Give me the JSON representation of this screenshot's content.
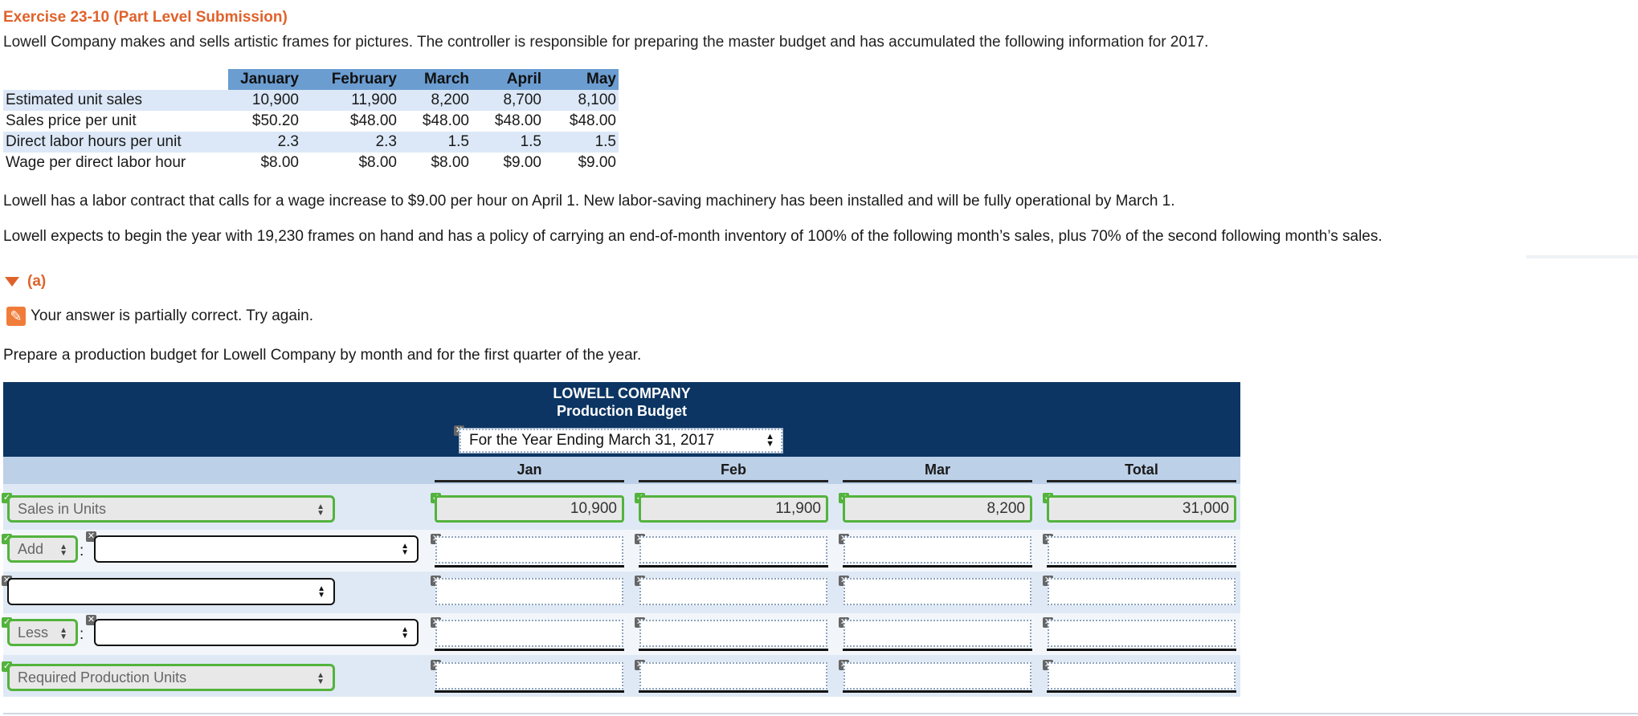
{
  "exercise": {
    "title": "Exercise 23-10 (Part Level Submission)",
    "intro": "Lowell Company makes and sells artistic frames for pictures. The controller is responsible for preparing the master budget and has accumulated the following information for 2017."
  },
  "info_table": {
    "columns": [
      "January",
      "February",
      "March",
      "April",
      "May"
    ],
    "rows": [
      {
        "label": "Estimated unit sales",
        "values": [
          "10,900",
          "11,900",
          "8,200",
          "8,700",
          "8,100"
        ]
      },
      {
        "label": "Sales price per unit",
        "values": [
          "$50.20",
          "$48.00",
          "$48.00",
          "$48.00",
          "$48.00"
        ]
      },
      {
        "label": "Direct labor hours per unit",
        "values": [
          "2.3",
          "2.3",
          "1.5",
          "1.5",
          "1.5"
        ]
      },
      {
        "label": "Wage per direct labor hour",
        "values": [
          "$8.00",
          "$8.00",
          "$8.00",
          "$9.00",
          "$9.00"
        ]
      }
    ]
  },
  "notes": {
    "labor": "Lowell has a labor contract that calls for a wage increase to $9.00 per hour on April 1. New labor-saving machinery has been installed and will be fully operational by March 1.",
    "inventory": "Lowell expects to begin the year with 19,230 frames on hand and has a policy of carrying an end-of-month inventory of 100% of the following month’s sales, plus 70% of the second following month’s sales."
  },
  "part": {
    "label": "(a)",
    "feedback": "Your answer is partially correct.  Try again.",
    "instruction": "Prepare a production budget for Lowell Company by month and for the first quarter of the year."
  },
  "budget": {
    "company": "LOWELL COMPANY",
    "name": "Production Budget",
    "period": "For the Year Ending March 31, 2017",
    "columns": [
      "Jan",
      "Feb",
      "Mar",
      "Total"
    ],
    "rows": [
      {
        "label": "Sales in Units",
        "values": [
          "10,900",
          "11,900",
          "8,200",
          "31,000"
        ]
      },
      {
        "prefix": "Add",
        "label": "",
        "values": [
          "",
          "",
          "",
          ""
        ]
      },
      {
        "label": "",
        "values": [
          "",
          "",
          "",
          ""
        ]
      },
      {
        "prefix": "Less",
        "label": "",
        "values": [
          "",
          "",
          "",
          ""
        ]
      },
      {
        "label": "Required Production Units",
        "values": [
          "",
          "",
          "",
          ""
        ]
      }
    ]
  },
  "icons": {
    "check": "check-icon",
    "cross": "cross-icon",
    "pencil": "pencil-icon"
  },
  "colors": {
    "accent": "#e0622b",
    "header_navy": "#0c3563",
    "correct_green": "#53b33d"
  }
}
